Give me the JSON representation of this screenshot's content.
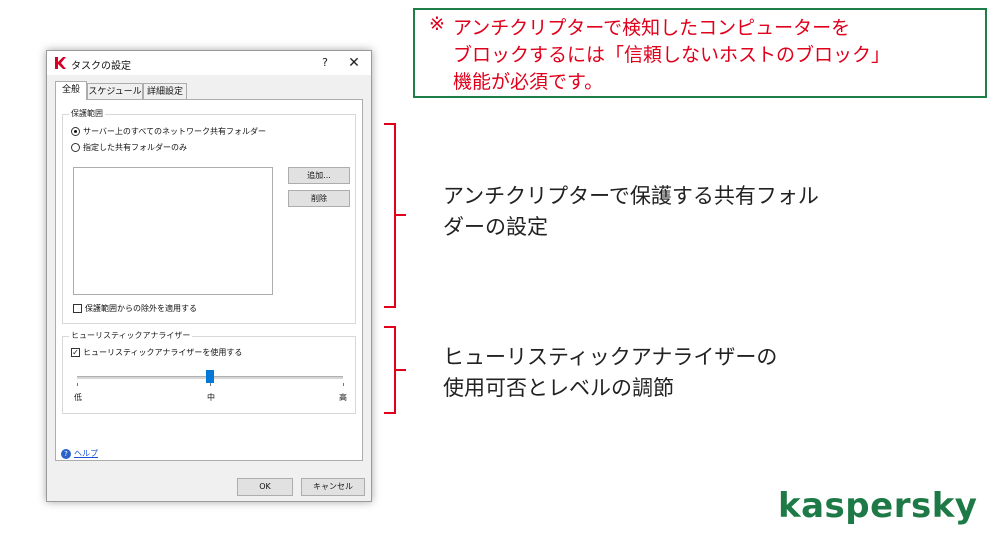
{
  "dialog": {
    "title": "タスクの設定",
    "help_glyph": "?",
    "close_glyph": "✕",
    "tabs": [
      {
        "label": "全般",
        "active": true
      },
      {
        "label": "スケジュール",
        "active": false
      },
      {
        "label": "詳細設定",
        "active": false
      }
    ],
    "protection_scope": {
      "label": "保護範囲",
      "options": [
        {
          "label": "サーバー上のすべてのネットワーク共有フォルダー",
          "selected": true
        },
        {
          "label": "指定した共有フォルダーのみ",
          "selected": false
        }
      ],
      "add_button": "追加...",
      "delete_button": "削除",
      "apply_exclusions": {
        "label": "保護範囲からの除外を適用する",
        "checked": false
      }
    },
    "heuristic": {
      "label": "ヒューリスティックアナライザー",
      "use": {
        "label": "ヒューリスティックアナライザーを使用する",
        "checked": true
      },
      "level_labels": [
        "低",
        "中",
        "高"
      ],
      "level": 0.5
    },
    "help_link": "ヘルプ",
    "ok_button": "OK",
    "cancel_button": "キャンセル"
  },
  "notice": {
    "mark": "※",
    "lines": [
      "アンチクリプターで検知したコンピューターを",
      "ブロックするには「信頼しないホストのブロック」",
      "機能が必須です。"
    ]
  },
  "callouts": [
    {
      "lines": [
        "アンチクリプターで保護する共有フォル",
        "ダーの設定"
      ]
    },
    {
      "lines": [
        "ヒューリスティックアナライザーの",
        "使用可否とレベルの調節"
      ]
    }
  ],
  "brand": "kaspersky",
  "colors": {
    "accent_red": "#e0001b",
    "brand_green": "#1d7a46",
    "slider_blue": "#0078d7"
  }
}
